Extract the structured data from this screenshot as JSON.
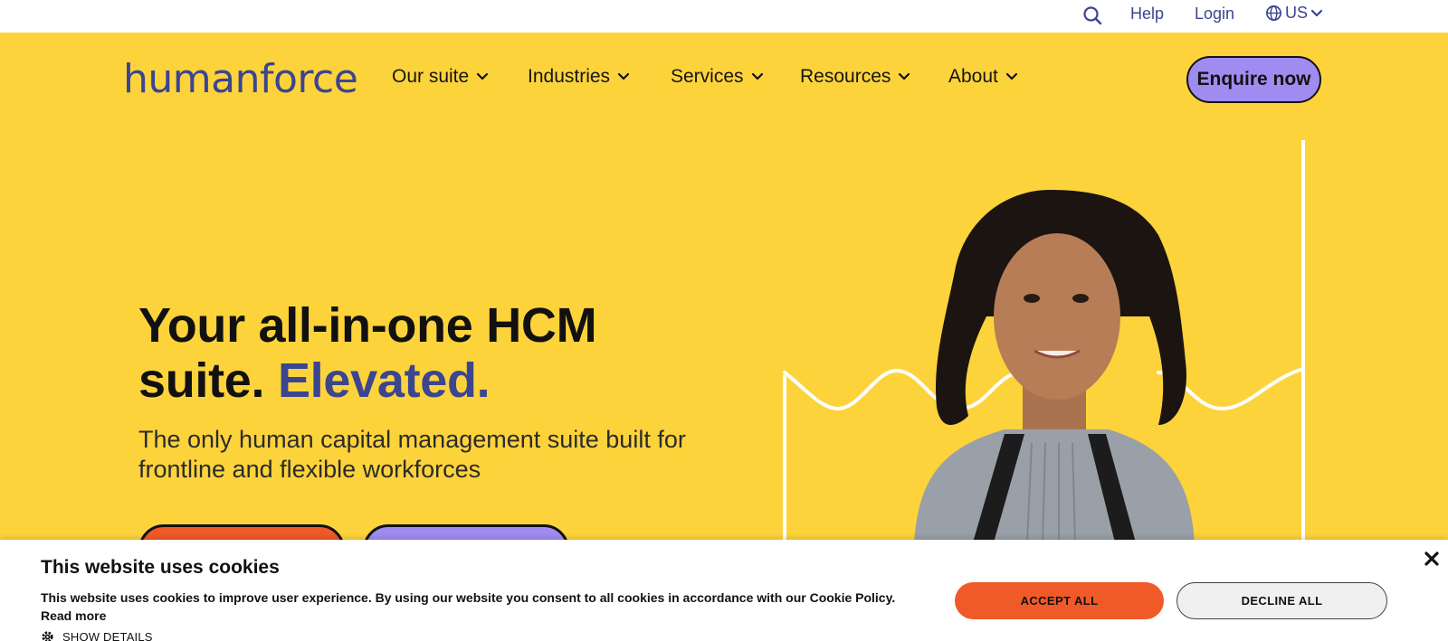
{
  "topbar": {
    "search_icon": "search-icon",
    "help_label": "Help",
    "login_label": "Login",
    "locale_icon": "globe-icon",
    "locale_label": "US"
  },
  "header": {
    "logo_text": "humanforce",
    "nav": [
      {
        "label": "Our suite"
      },
      {
        "label": "Industries"
      },
      {
        "label": "Services"
      },
      {
        "label": "Resources"
      },
      {
        "label": "About"
      }
    ],
    "enquire_label": "Enquire now"
  },
  "hero": {
    "headline_line1": "Your all-in-one HCM",
    "headline_line2_plain": "suite.",
    "headline_line2_accent": "Elevated.",
    "subhead": "The only human capital management suite built for frontline and flexible workforces"
  },
  "cookie_banner": {
    "title": "This website uses cookies",
    "text": "This website uses cookies to improve user experience. By using our website you consent to all cookies in accordance with our Cookie Policy.",
    "read_more": "Read more",
    "show_details": "SHOW DETAILS",
    "accept_label": "ACCEPT ALL",
    "decline_label": "DECLINE ALL",
    "close_icon": "close-icon"
  },
  "colors": {
    "background": "#fdd33c",
    "brand_navy": "#3b4590",
    "purple": "#a08cf0",
    "orange": "#f05a28"
  }
}
